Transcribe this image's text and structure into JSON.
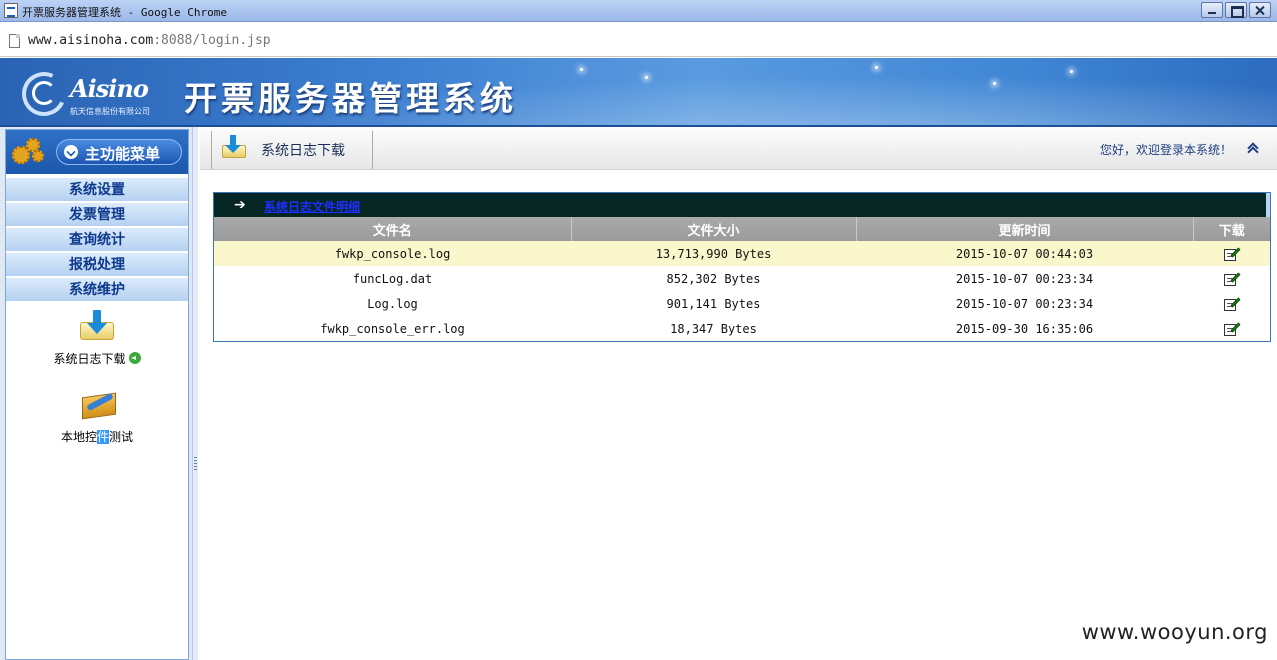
{
  "window": {
    "title": "开票服务器管理系统 - Google Chrome"
  },
  "address_bar": {
    "url_host": "www.aisinoha.com",
    "url_rest": ":8088/login.jsp"
  },
  "banner": {
    "brand": "Aisino",
    "company": "航天信息股份有限公司",
    "system_title": "开票服务器管理系统"
  },
  "sidebar": {
    "menu_title": "主功能菜单",
    "items": [
      {
        "label": "系统设置"
      },
      {
        "label": "发票管理"
      },
      {
        "label": "查询统计"
      },
      {
        "label": "报税处理"
      },
      {
        "label": "系统维护"
      }
    ],
    "tools": [
      {
        "label": "系统日志下载",
        "icon": "download-folder-icon"
      },
      {
        "label_pre": "本地控",
        "label_sel": "件",
        "label_post": "测试",
        "icon": "toolbox-icon"
      }
    ]
  },
  "header": {
    "crumb_title": "系统日志下载",
    "welcome": "您好，欢迎登录本系统！"
  },
  "panel": {
    "link_text": "系统日志文件明细"
  },
  "table": {
    "columns": [
      "文件名",
      "文件大小",
      "更新时间",
      "下载"
    ],
    "rows": [
      {
        "name": "fwkp_console.log",
        "size": "13,713,990 Bytes",
        "time": "2015-10-07 00:44:03",
        "highlighted": true
      },
      {
        "name": "funcLog.dat",
        "size": "852,302 Bytes",
        "time": "2015-10-07 00:23:34"
      },
      {
        "name": "Log.log",
        "size": "901,141 Bytes",
        "time": "2015-10-07 00:23:34"
      },
      {
        "name": "fwkp_console_err.log",
        "size": "18,347 Bytes",
        "time": "2015-09-30 16:35:06"
      }
    ]
  },
  "watermark": "www.wooyun.org",
  "colors": {
    "banner_blue": "#3d7fd0",
    "panel_head": "#062623",
    "highlight_row": "#fbf7cc",
    "menu_text": "#0d3a8c"
  }
}
